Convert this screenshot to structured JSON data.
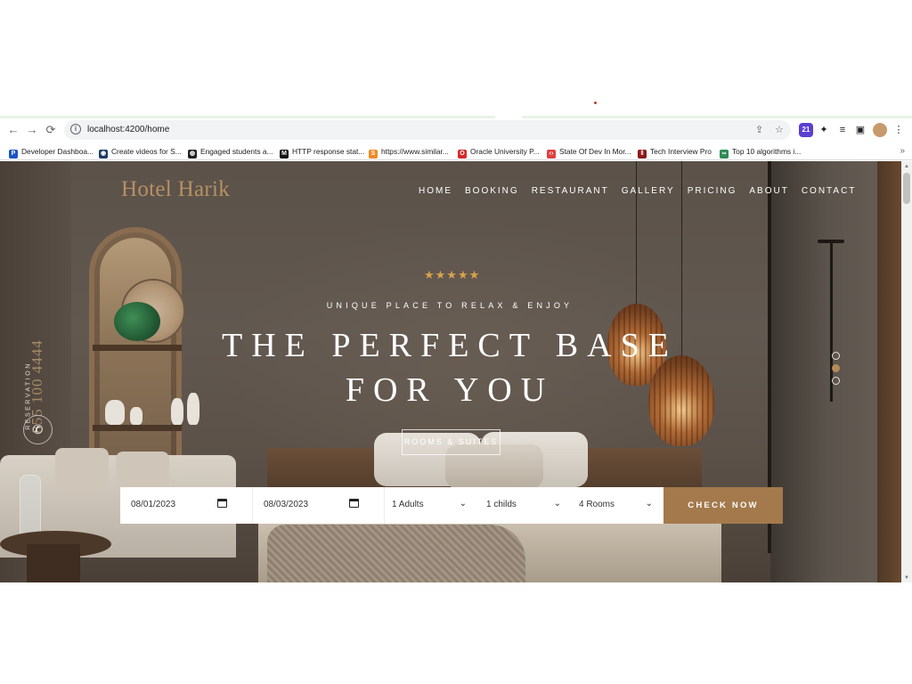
{
  "browser": {
    "url": "localhost:4200/home",
    "back_icon": "←",
    "forward_icon": "→",
    "reload_icon": "⟳",
    "info_icon": "i",
    "share_icon": "⇪",
    "star_icon": "☆",
    "extensions": {
      "badge_count": "21",
      "puzzle_icon": "✦",
      "playlist_icon": "≡",
      "sidepanel_icon": "▣",
      "menu_icon": "⋮"
    },
    "bookmarks": [
      {
        "label": "Developer Dashboa...",
        "color": "#1a56c4",
        "glyph": "P"
      },
      {
        "label": "Create videos for S...",
        "color": "#1f3b64",
        "glyph": "◉"
      },
      {
        "label": "Engaged students a...",
        "color": "#222222",
        "glyph": "◍"
      },
      {
        "label": "HTTP response stat...",
        "color": "#111111",
        "glyph": "M"
      },
      {
        "label": "https://www.similar...",
        "color": "#f08a24",
        "glyph": "S"
      },
      {
        "label": "Oracle University P...",
        "color": "#d62a2a",
        "glyph": "O"
      },
      {
        "label": "State Of Dev In Mor...",
        "color": "#e04040",
        "glyph": "‹›"
      },
      {
        "label": "Tech Interview Pro",
        "color": "#8b1a1a",
        "glyph": "‖"
      },
      {
        "label": "Top 10 algorithms i...",
        "color": "#2e8b57",
        "glyph": "∞"
      }
    ],
    "bookmarks_more": "»"
  },
  "site": {
    "logo": "Hotel Harik",
    "nav": [
      "HOME",
      "BOOKING",
      "RESTAURANT",
      "GALLERY",
      "PRICING",
      "ABOUT",
      "CONTACT"
    ],
    "stars": "★★★★★",
    "subtitle": "UNIQUE PLACE TO RELAX & ENJOY",
    "headline_line1": "THE PERFECT BASE",
    "headline_line2": "FOR YOU",
    "rooms_button": "ROOMS & SUITES",
    "reservation_label": "RESERVATION",
    "reservation_phone": "855 100 4444",
    "phone_icon": "✆"
  },
  "booking": {
    "check_in": "08/01/2023",
    "check_out": "08/03/2023",
    "adults": "1 Adults",
    "children": "1 childs",
    "rooms": "4 Rooms",
    "submit": "CHECK NOW",
    "chevron": "⌄"
  },
  "colors": {
    "accent": "#a47a4c",
    "logo": "#b89064",
    "stars": "#d9a24a"
  },
  "slider": {
    "slides": 3,
    "active_index": 1
  }
}
